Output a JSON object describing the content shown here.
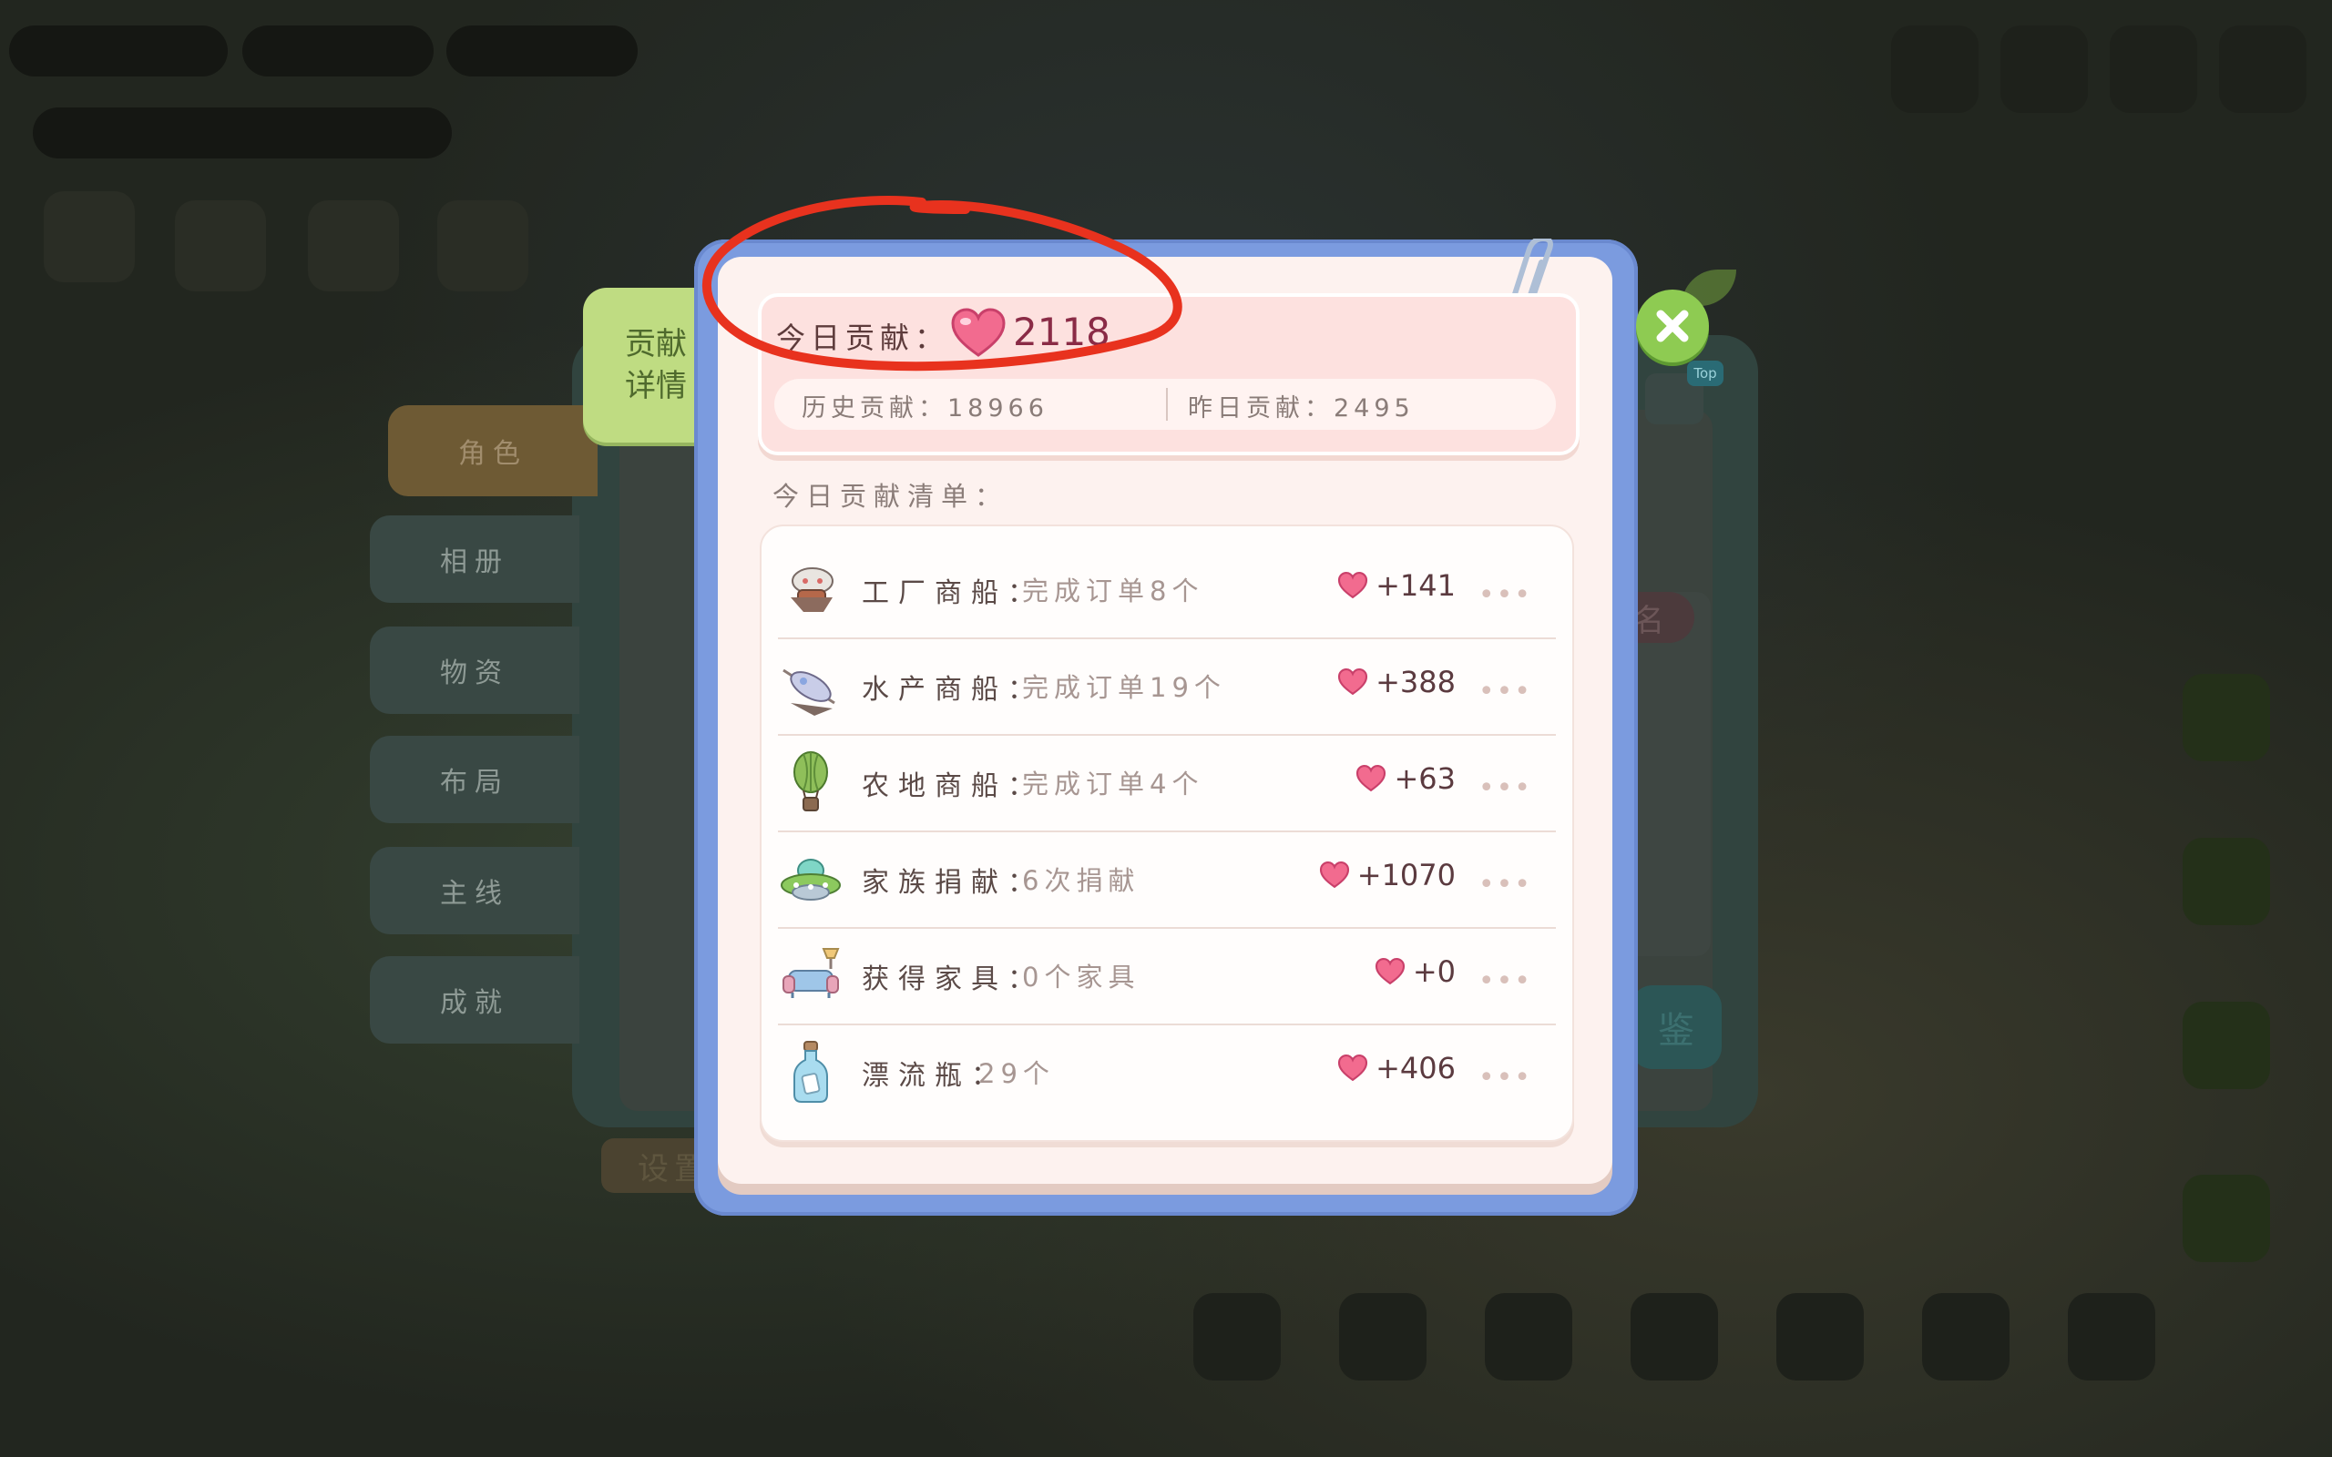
{
  "side_tabs": [
    "角色",
    "相册",
    "物资",
    "布局",
    "主线",
    "成就"
  ],
  "detail_tab": "贡献详情",
  "header": {
    "today_label": "今日贡献：",
    "today_value": "2118",
    "history": "历史贡献：18966",
    "yesterday": "昨日贡献：2495"
  },
  "list_title": "今日贡献清单：",
  "rows": [
    {
      "name": "工厂商船：",
      "desc": "完成订单8个",
      "value": "+141",
      "icon": "factory-ship-icon"
    },
    {
      "name": "水产商船：",
      "desc": "完成订单19个",
      "value": "+388",
      "icon": "fishery-ship-icon"
    },
    {
      "name": "农地商船：",
      "desc": "完成订单4个",
      "value": "+63",
      "icon": "hot-air-balloon-icon"
    },
    {
      "name": "家族捐献：",
      "desc": "6次捐献",
      "value": "+1070",
      "icon": "ufo-icon"
    },
    {
      "name": "获得家具：",
      "desc": "0个家具",
      "value": "+0",
      "icon": "sofa-icon"
    },
    {
      "name": "漂流瓶：",
      "desc": "29个",
      "value": "+406",
      "icon": "bottle-icon"
    }
  ],
  "more_glyph": "•••",
  "back": {
    "settings": "设置",
    "rank": "名",
    "confirm": "鉴",
    "top_badge": "Top"
  },
  "colors": {
    "heart": "#f26b8f",
    "annotation": "#e8321e",
    "frame": "#7b9bdf"
  }
}
